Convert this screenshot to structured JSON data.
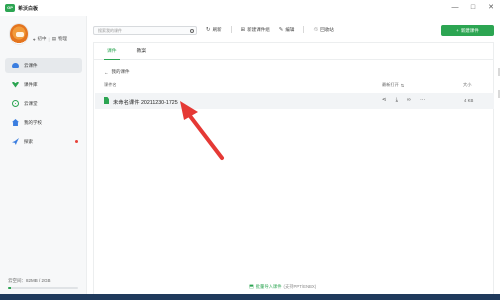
{
  "app": {
    "logo_text": "GP",
    "title": "希沃白板"
  },
  "window_controls": [
    "—",
    "□",
    "✕"
  ],
  "user": {
    "grade": "初中",
    "subject": "物理"
  },
  "sidebar": {
    "items": [
      {
        "label": "云课件",
        "icon": "cloud-icon",
        "active": true
      },
      {
        "label": "课件库",
        "icon": "wifi-icon",
        "active": false
      },
      {
        "label": "云课堂",
        "icon": "circle-play-icon",
        "active": false
      },
      {
        "label": "我的学校",
        "icon": "school-icon",
        "active": false
      },
      {
        "label": "探索",
        "icon": "rocket-icon",
        "active": false,
        "badge": true
      }
    ],
    "storage": {
      "label": "云空间：82MB / 2GB",
      "used_fraction": 0.04
    }
  },
  "toolbar": {
    "search_placeholder": "搜索我的课件",
    "refresh": "刷新",
    "new_folder": "新建课件组",
    "edit": "编辑",
    "recycle": "回收站",
    "new_courseware": "新建课件"
  },
  "tabs": [
    {
      "label": "课件",
      "active": true
    },
    {
      "label": "教案",
      "active": false
    }
  ],
  "breadcrumb": "我的课件",
  "columns": {
    "name": "课件名",
    "time": "最新打开",
    "size": "大小"
  },
  "files": [
    {
      "name": "未命名课件 20211230-1725",
      "size": "4 KB"
    }
  ],
  "bulk_import": {
    "label": "批量导入课件",
    "hint": "(支持PPT/ENBX)"
  },
  "colors": {
    "accent": "#2ca552",
    "arrow": "#e53935"
  }
}
